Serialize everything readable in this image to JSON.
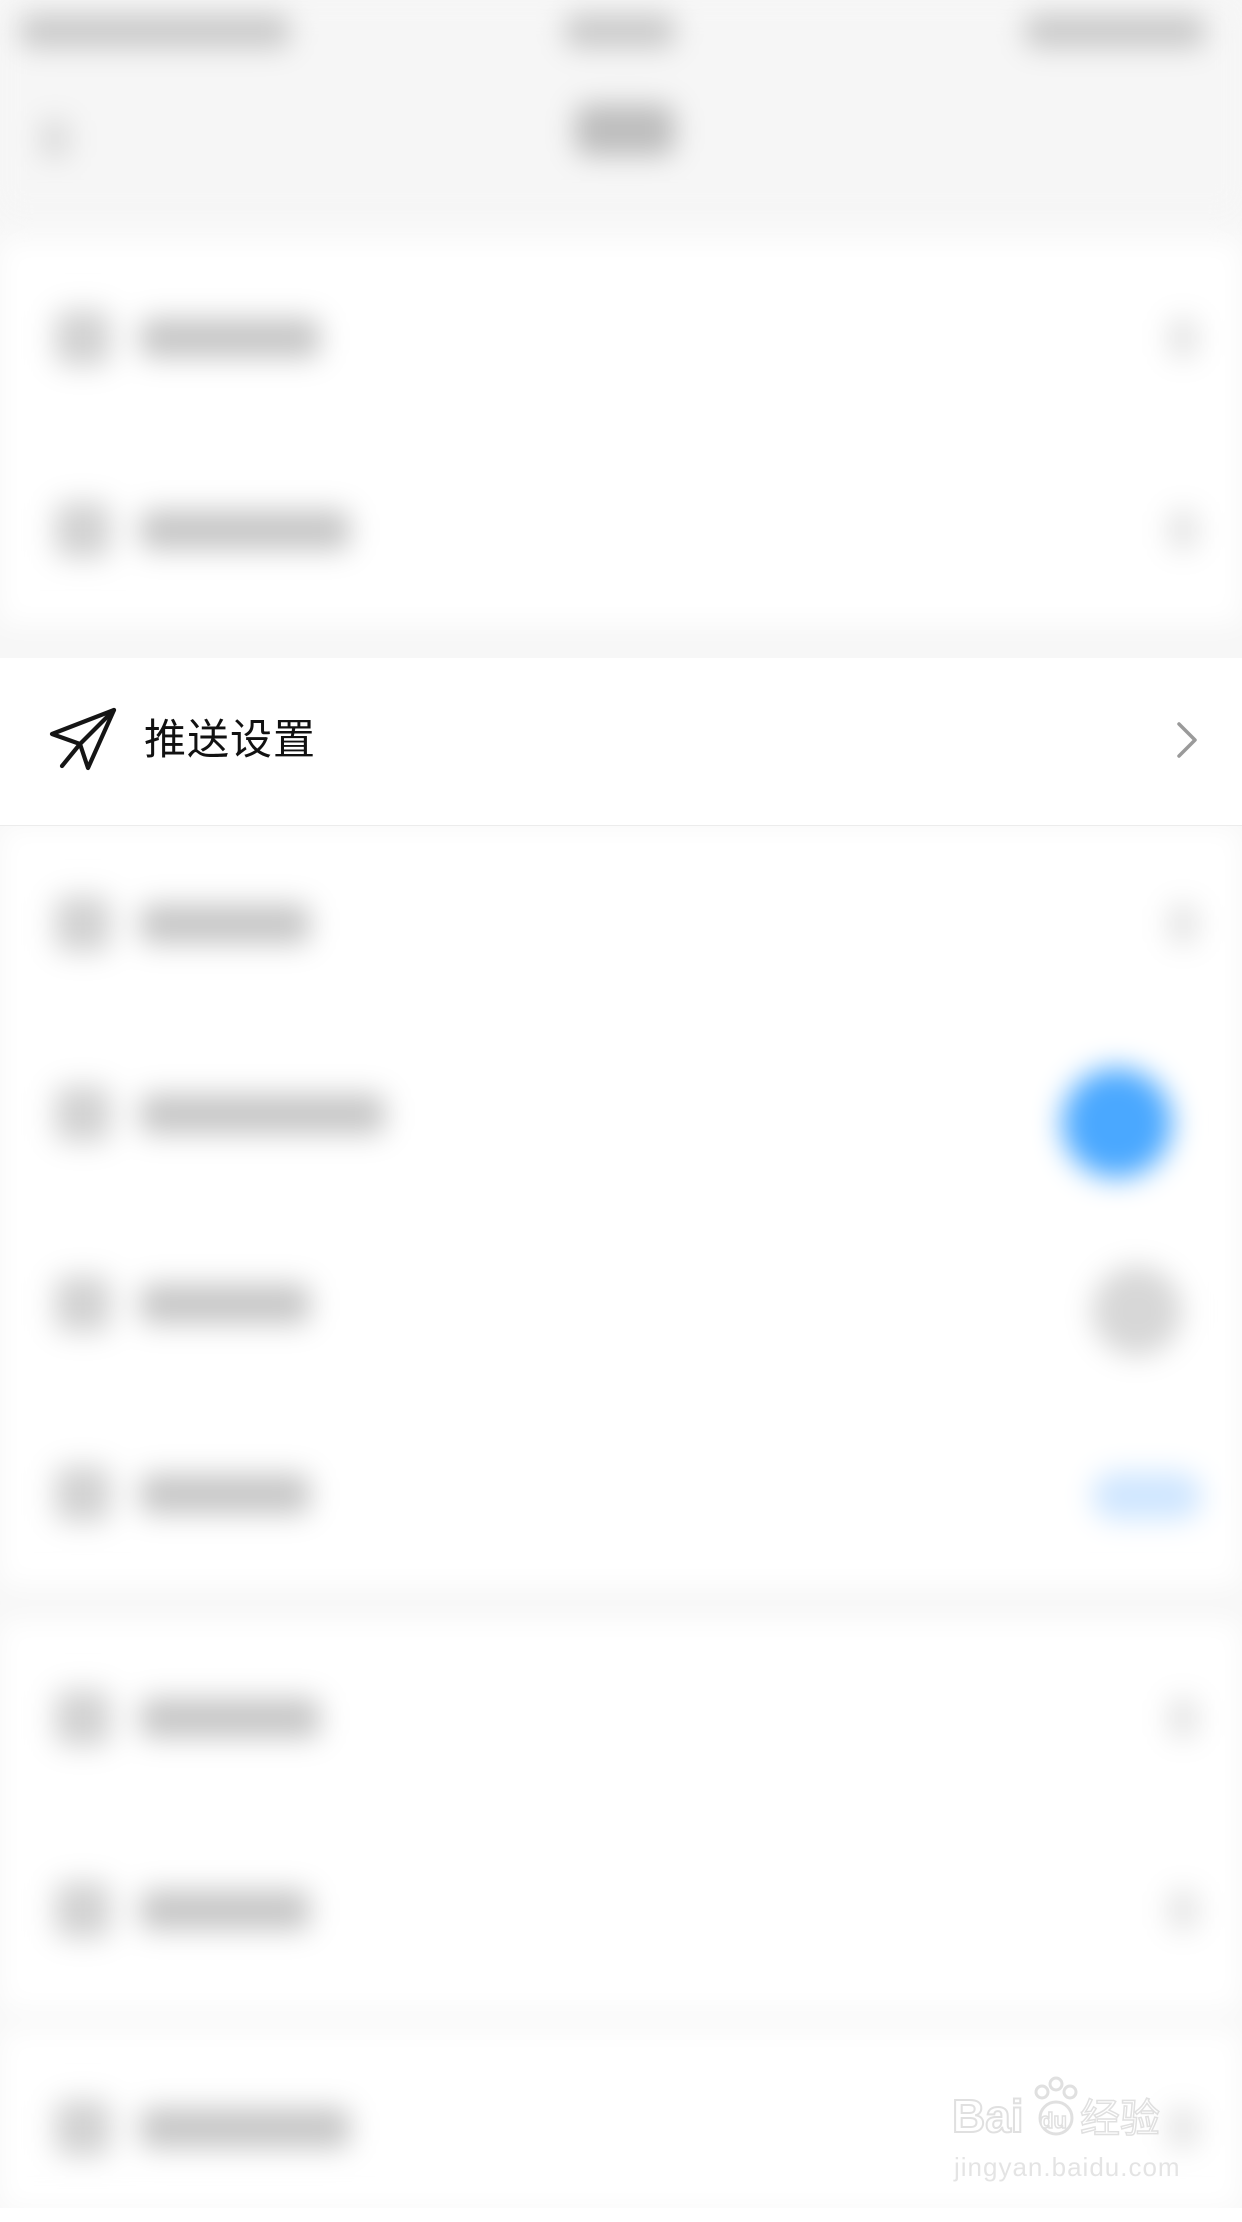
{
  "push_row": {
    "label": "推送设置",
    "icon": "paper-plane-icon",
    "chevron_icon": "chevron-right-icon"
  },
  "watermark": {
    "brand": "Baidu经验",
    "url": "jingyan.baidu.com"
  },
  "colors": {
    "background": "#f7f7f7",
    "row_background": "#ffffff",
    "toggle_accent": "#4aa8ff",
    "text": "#111111",
    "chevron": "#9a9a9a"
  }
}
